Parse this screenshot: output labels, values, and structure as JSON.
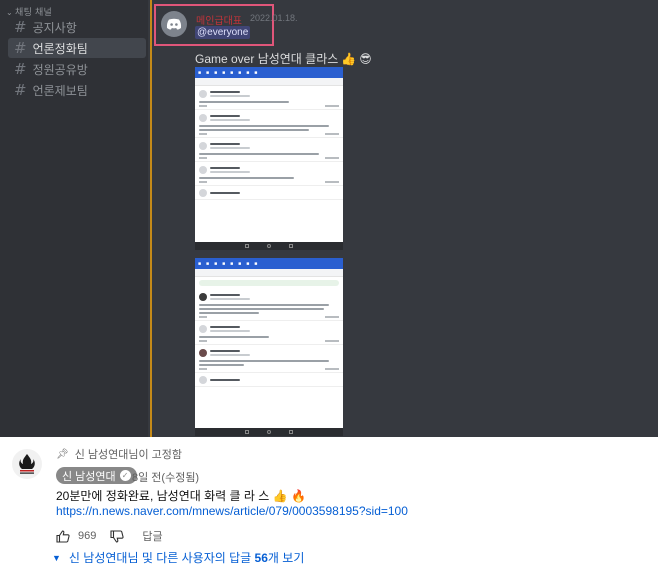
{
  "discord": {
    "category": "채팅 채널",
    "channels": [
      {
        "label": "공지사항",
        "active": false
      },
      {
        "label": "언론정화팀",
        "active": true
      },
      {
        "label": "정원공유방",
        "active": false
      },
      {
        "label": "언론제보팀",
        "active": false
      }
    ],
    "message": {
      "author": "메인급대표",
      "timestamp": "2022.01.18.",
      "mention": "@everyone",
      "text": "Game over 남성연대 클라스",
      "emojis": [
        "👍",
        "😎"
      ]
    },
    "colors": {
      "divider": "#c58a18",
      "highlight": "#e0567a",
      "author": "#c0343a"
    }
  },
  "comment": {
    "pinned_text": "신 남성연대님이 고정함",
    "author": "신 남성연대",
    "time": "8일 전(수정됨)",
    "text": "20분만에 정화완료, 남성연대 화력 클 라 스",
    "text_emojis": [
      "👍",
      "🔥"
    ],
    "link": "https://n.news.naver.com/mnews/article/079/0003598195?sid=100",
    "likes": "969",
    "reply_label": "답글",
    "replies_prefix": "신 남성연대님 및 다른 사용자의 답글",
    "replies_count": "56",
    "replies_suffix": "개 보기"
  }
}
